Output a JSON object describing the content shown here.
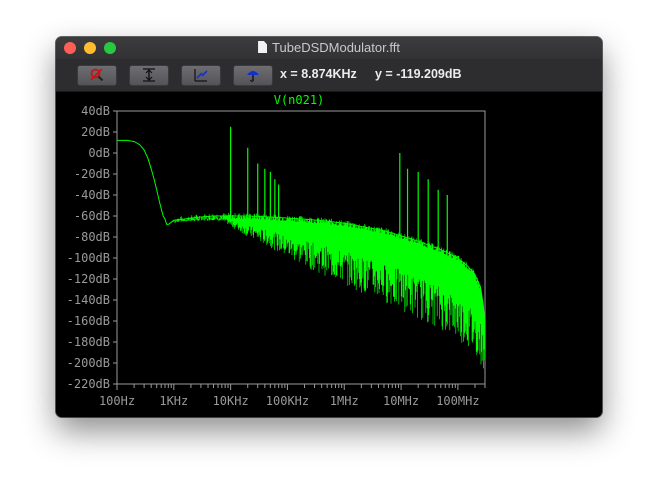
{
  "window": {
    "title": "TubeDSDModulator.fft"
  },
  "toolbar": {
    "buttons": [
      {
        "name": "zoom-cancel",
        "icon": "magnifier-cancel-icon"
      },
      {
        "name": "autorange-y",
        "icon": "autorange-y-icon"
      },
      {
        "name": "autorange-x",
        "icon": "autorange-x-icon"
      },
      {
        "name": "pick-traces",
        "icon": "umbrella-probe-icon"
      }
    ],
    "cursor": {
      "x_text": "x = 8.874KHz",
      "y_text": "y = -119.209dB"
    }
  },
  "chart_data": {
    "type": "line",
    "title": "V(n021)",
    "x_scale": "log",
    "xlim": [
      100,
      300000000
    ],
    "ylim": [
      -220,
      40
    ],
    "x_ticks": [
      {
        "value": 100,
        "label": "100Hz"
      },
      {
        "value": 1000,
        "label": "1KHz"
      },
      {
        "value": 10000,
        "label": "10KHz"
      },
      {
        "value": 100000,
        "label": "100KHz"
      },
      {
        "value": 1000000,
        "label": "1MHz"
      },
      {
        "value": 10000000,
        "label": "10MHz"
      },
      {
        "value": 100000000,
        "label": "100MHz"
      }
    ],
    "y_ticks": [
      {
        "value": 40,
        "label": "40dB"
      },
      {
        "value": 20,
        "label": "20dB"
      },
      {
        "value": 0,
        "label": "0dB"
      },
      {
        "value": -20,
        "label": "-20dB"
      },
      {
        "value": -40,
        "label": "-40dB"
      },
      {
        "value": -60,
        "label": "-60dB"
      },
      {
        "value": -80,
        "label": "-80dB"
      },
      {
        "value": -100,
        "label": "-100dB"
      },
      {
        "value": -120,
        "label": "-120dB"
      },
      {
        "value": -140,
        "label": "-140dB"
      },
      {
        "value": -160,
        "label": "-160dB"
      },
      {
        "value": -180,
        "label": "-180dB"
      },
      {
        "value": -200,
        "label": "-200dB"
      },
      {
        "value": -220,
        "label": "-220dB"
      }
    ],
    "series": [
      {
        "color": "#00ff00",
        "x": [
          100,
          150,
          200,
          250,
          300,
          350,
          400,
          450,
          500,
          550,
          600,
          650,
          700,
          750,
          800,
          900,
          1000,
          1500,
          2000,
          3000,
          5000,
          8000,
          10000,
          20000,
          50000,
          100000,
          200000,
          500000,
          1000000,
          2000000,
          5000000,
          10000000,
          20000000,
          50000000,
          100000000,
          150000000,
          200000000,
          250000000,
          280000000,
          300000000
        ],
        "y": [
          12,
          12,
          11,
          8,
          3,
          -5,
          -15,
          -25,
          -35,
          -45,
          -53,
          -60,
          -63,
          -68,
          -68,
          -66,
          -64,
          -63,
          -62,
          -61,
          -60,
          -60,
          -60,
          -60,
          -61,
          -62,
          -63,
          -65,
          -67,
          -70,
          -74,
          -79,
          -84,
          -92,
          -100,
          -108,
          -116,
          -128,
          -145,
          -165
        ],
        "band_low": [
          12,
          12,
          11,
          8,
          3,
          -5,
          -15,
          -25,
          -35,
          -45,
          -53,
          -60,
          -63,
          -68,
          -68,
          -66,
          -66,
          -65,
          -65,
          -65,
          -64,
          -66,
          -70,
          -80,
          -90,
          -100,
          -108,
          -118,
          -125,
          -133,
          -142,
          -150,
          -158,
          -168,
          -178,
          -186,
          -192,
          -200,
          -208,
          -218
        ],
        "peaks": [
          {
            "x": 10000,
            "y": 25
          },
          {
            "x": 20000,
            "y": 5
          },
          {
            "x": 30000,
            "y": -10
          },
          {
            "x": 40000,
            "y": -15
          },
          {
            "x": 50000,
            "y": -18
          },
          {
            "x": 60000,
            "y": -25
          },
          {
            "x": 70000,
            "y": -30
          },
          {
            "x": 9500000,
            "y": 0
          },
          {
            "x": 13000000,
            "y": -15
          },
          {
            "x": 20000000,
            "y": -18
          },
          {
            "x": 30000000,
            "y": -25
          },
          {
            "x": 45000000,
            "y": -35
          },
          {
            "x": 65000000,
            "y": -40
          }
        ]
      }
    ]
  }
}
